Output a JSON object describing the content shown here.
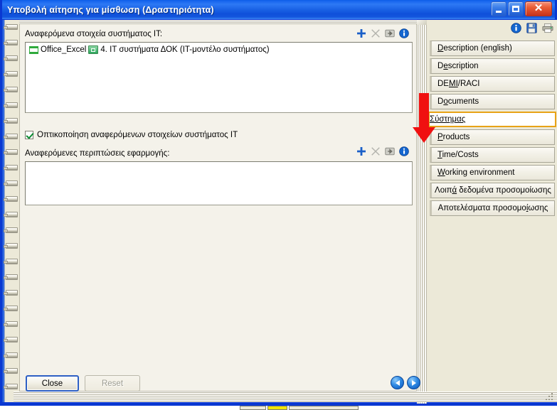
{
  "window": {
    "title": "Υποβολή αίτησης για μίσθωση (Δραστηριότητα)",
    "minimize_label": "Minimize",
    "maximize_label": "Maximize",
    "close_label": "✕"
  },
  "main": {
    "group1": {
      "label": "Αναφερόμενα στοιχεία συστήματος IT:",
      "items": [
        {
          "name": "Office_Excel",
          "detail": "4. IT συστήματα ΔΟΚ (IT-μοντέλο συστήματος)"
        }
      ],
      "icons": [
        "add-icon",
        "delete-icon",
        "open-icon",
        "info-icon"
      ]
    },
    "checkbox": {
      "label": "Οπτικοποίηση αναφερόμενων στοιχείων συστήματος IT",
      "checked": true
    },
    "group2": {
      "label": "Αναφερόμενες περιπτώσεις εφαρμογής:",
      "items": [],
      "icons": [
        "add-icon",
        "delete-icon",
        "open-icon",
        "info-icon"
      ]
    }
  },
  "footer": {
    "close_label": "Close",
    "reset_label": "Reset",
    "reset_disabled": true,
    "prev_label": "◀",
    "next_label": "▶"
  },
  "tabs": {
    "toolbar_icons": [
      "info-icon",
      "save-icon",
      "print-icon"
    ],
    "items": [
      {
        "label": "Description (english)",
        "accel_prefix": "",
        "accel": "D",
        "rest": "escription (english)",
        "selected": false,
        "centered": false
      },
      {
        "label": "Description",
        "accel_prefix": "D",
        "accel": "e",
        "rest": "scription",
        "selected": false,
        "centered": false
      },
      {
        "label": "DEMI/RACI",
        "accel_prefix": "DE",
        "accel": "MI",
        "rest": "/RACI",
        "selected": false,
        "centered": false
      },
      {
        "label": "Documents",
        "accel_prefix": "D",
        "accel": "o",
        "rest": "cuments",
        "selected": false,
        "centered": false
      },
      {
        "label": "Σύστημας",
        "accel_prefix": "",
        "accel": "Σύστημας",
        "rest": "",
        "selected": true,
        "centered": false
      },
      {
        "label": "Products",
        "accel_prefix": "",
        "accel": "P",
        "rest": "roducts",
        "selected": false,
        "centered": false
      },
      {
        "label": "Time/Costs",
        "accel_prefix": "",
        "accel": "T",
        "rest": "ime/Costs",
        "selected": false,
        "centered": false
      },
      {
        "label": "Working environment",
        "accel_prefix": "",
        "accel": "W",
        "rest": "orking environment",
        "selected": false,
        "centered": false
      },
      {
        "label": "Λοιπά δεδομένα προσομοίωσης",
        "accel_prefix": "Λοιπ",
        "accel": "ά",
        "rest": " δεδομένα προσομοίωσης",
        "selected": false,
        "centered": true
      },
      {
        "label": "Αποτελέσματα προσομοίωσης",
        "accel_prefix": "Αποτελέσματα προσομο",
        "accel": "ί",
        "rest": "ωσης",
        "selected": false,
        "centered": true
      }
    ]
  },
  "annotation": {
    "type": "red-down-arrow",
    "points_at": "Σύστημας",
    "color": "#f01010"
  },
  "colors": {
    "titlebar_blue": "#1b63e6",
    "window_border": "#0a38d2",
    "client_bg": "#ece9d8",
    "paper_bg": "#f4f2ea",
    "listbox_bg": "#ffffff",
    "selected_tab_border": "#e8a317",
    "accent_icon_blue": "#1a5fc8",
    "check_green": "#0a8a30"
  }
}
